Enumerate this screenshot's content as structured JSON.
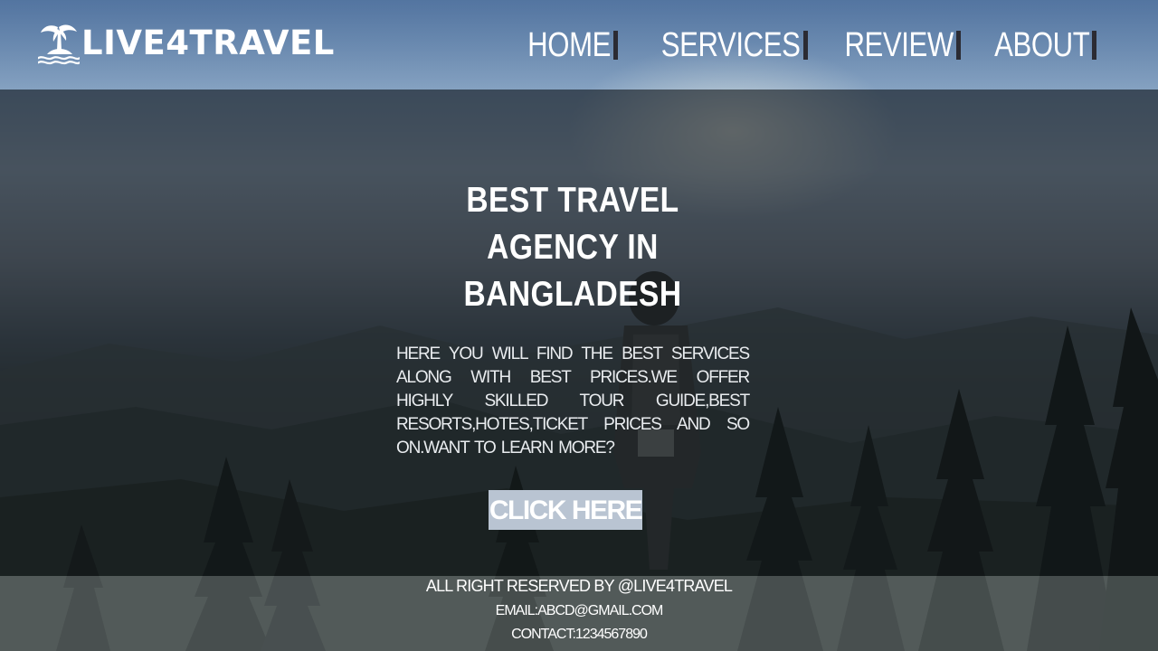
{
  "brand": {
    "logo_icon": "palm-island-icon",
    "name": "LIVE4TRAVEL"
  },
  "nav": {
    "items": [
      {
        "label": "HOME"
      },
      {
        "label": "SERVICES"
      },
      {
        "label": "REVIEW"
      },
      {
        "label": "ABOUT"
      }
    ]
  },
  "hero": {
    "title_line1": "BEST TRAVEL AGENCY IN",
    "title_line2": "BANGLADESH",
    "description": "HERE YOU WILL FIND THE BEST SERVICES ALONG WITH BEST PRICES.WE OFFER HIGHLY SKILLED TOUR GUIDE,BEST RESORTS,HOTES,TICKET PRICES AND SO ON.WANT TO LEARN MORE?",
    "cta_label": "CLICK HERE"
  },
  "footer": {
    "rights": "ALL RIGHT RESERVED BY @LIVE4TRAVEL",
    "email": "EMAIL:ABCD@GMAIL.COM",
    "contact": "CONTACT:1234567890"
  },
  "colors": {
    "cta_background": "#b9c4d2",
    "nav_separator": "#2b2b33",
    "text": "#ffffff"
  }
}
